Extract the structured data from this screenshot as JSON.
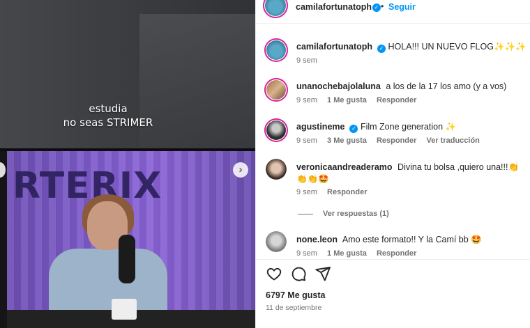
{
  "post": {
    "overlay_line1": "estudia",
    "overlay_line2": "no seas STRIMER",
    "screen_brand": "RTERIX"
  },
  "header": {
    "username": "camilafortunatoph",
    "separator": "•",
    "follow_label": "Seguir"
  },
  "caption": {
    "username": "camilafortunatoph",
    "text": "HOLA!!! UN NUEVO FLOG✨✨✨",
    "time": "9 sem"
  },
  "comments": [
    {
      "username": "unanochebajolaluna",
      "text": "a los de la 17 los amo (y a vos)",
      "time": "9 sem",
      "likes": "1 Me gusta",
      "reply": "Responder"
    },
    {
      "username": "agustineme",
      "text": "Film Zone generation ✨",
      "time": "9 sem",
      "likes": "3 Me gusta",
      "reply": "Responder",
      "translate": "Ver traducción"
    },
    {
      "username": "veronicaandreaderamo",
      "text": "Divina tu bolsa ,quiero una!!!👏👏👏🤩",
      "time": "9 sem",
      "reply": "Responder"
    },
    {
      "username": "none.leon",
      "text": "Amo este formato!! Y la Camí bb 🤩",
      "time": "9 sem",
      "likes": "1 Me gusta",
      "reply": "Responder"
    }
  ],
  "view_replies": "Ver respuestas (1)",
  "footer": {
    "likes": "6797 Me gusta",
    "date": "11 de septiembre"
  },
  "colors": {
    "accent": "#0095f6",
    "muted": "#737373",
    "text": "#262626"
  },
  "icons": [
    "heart-icon",
    "comment-icon",
    "share-icon",
    "verified-icon",
    "chevron-right-icon"
  ]
}
